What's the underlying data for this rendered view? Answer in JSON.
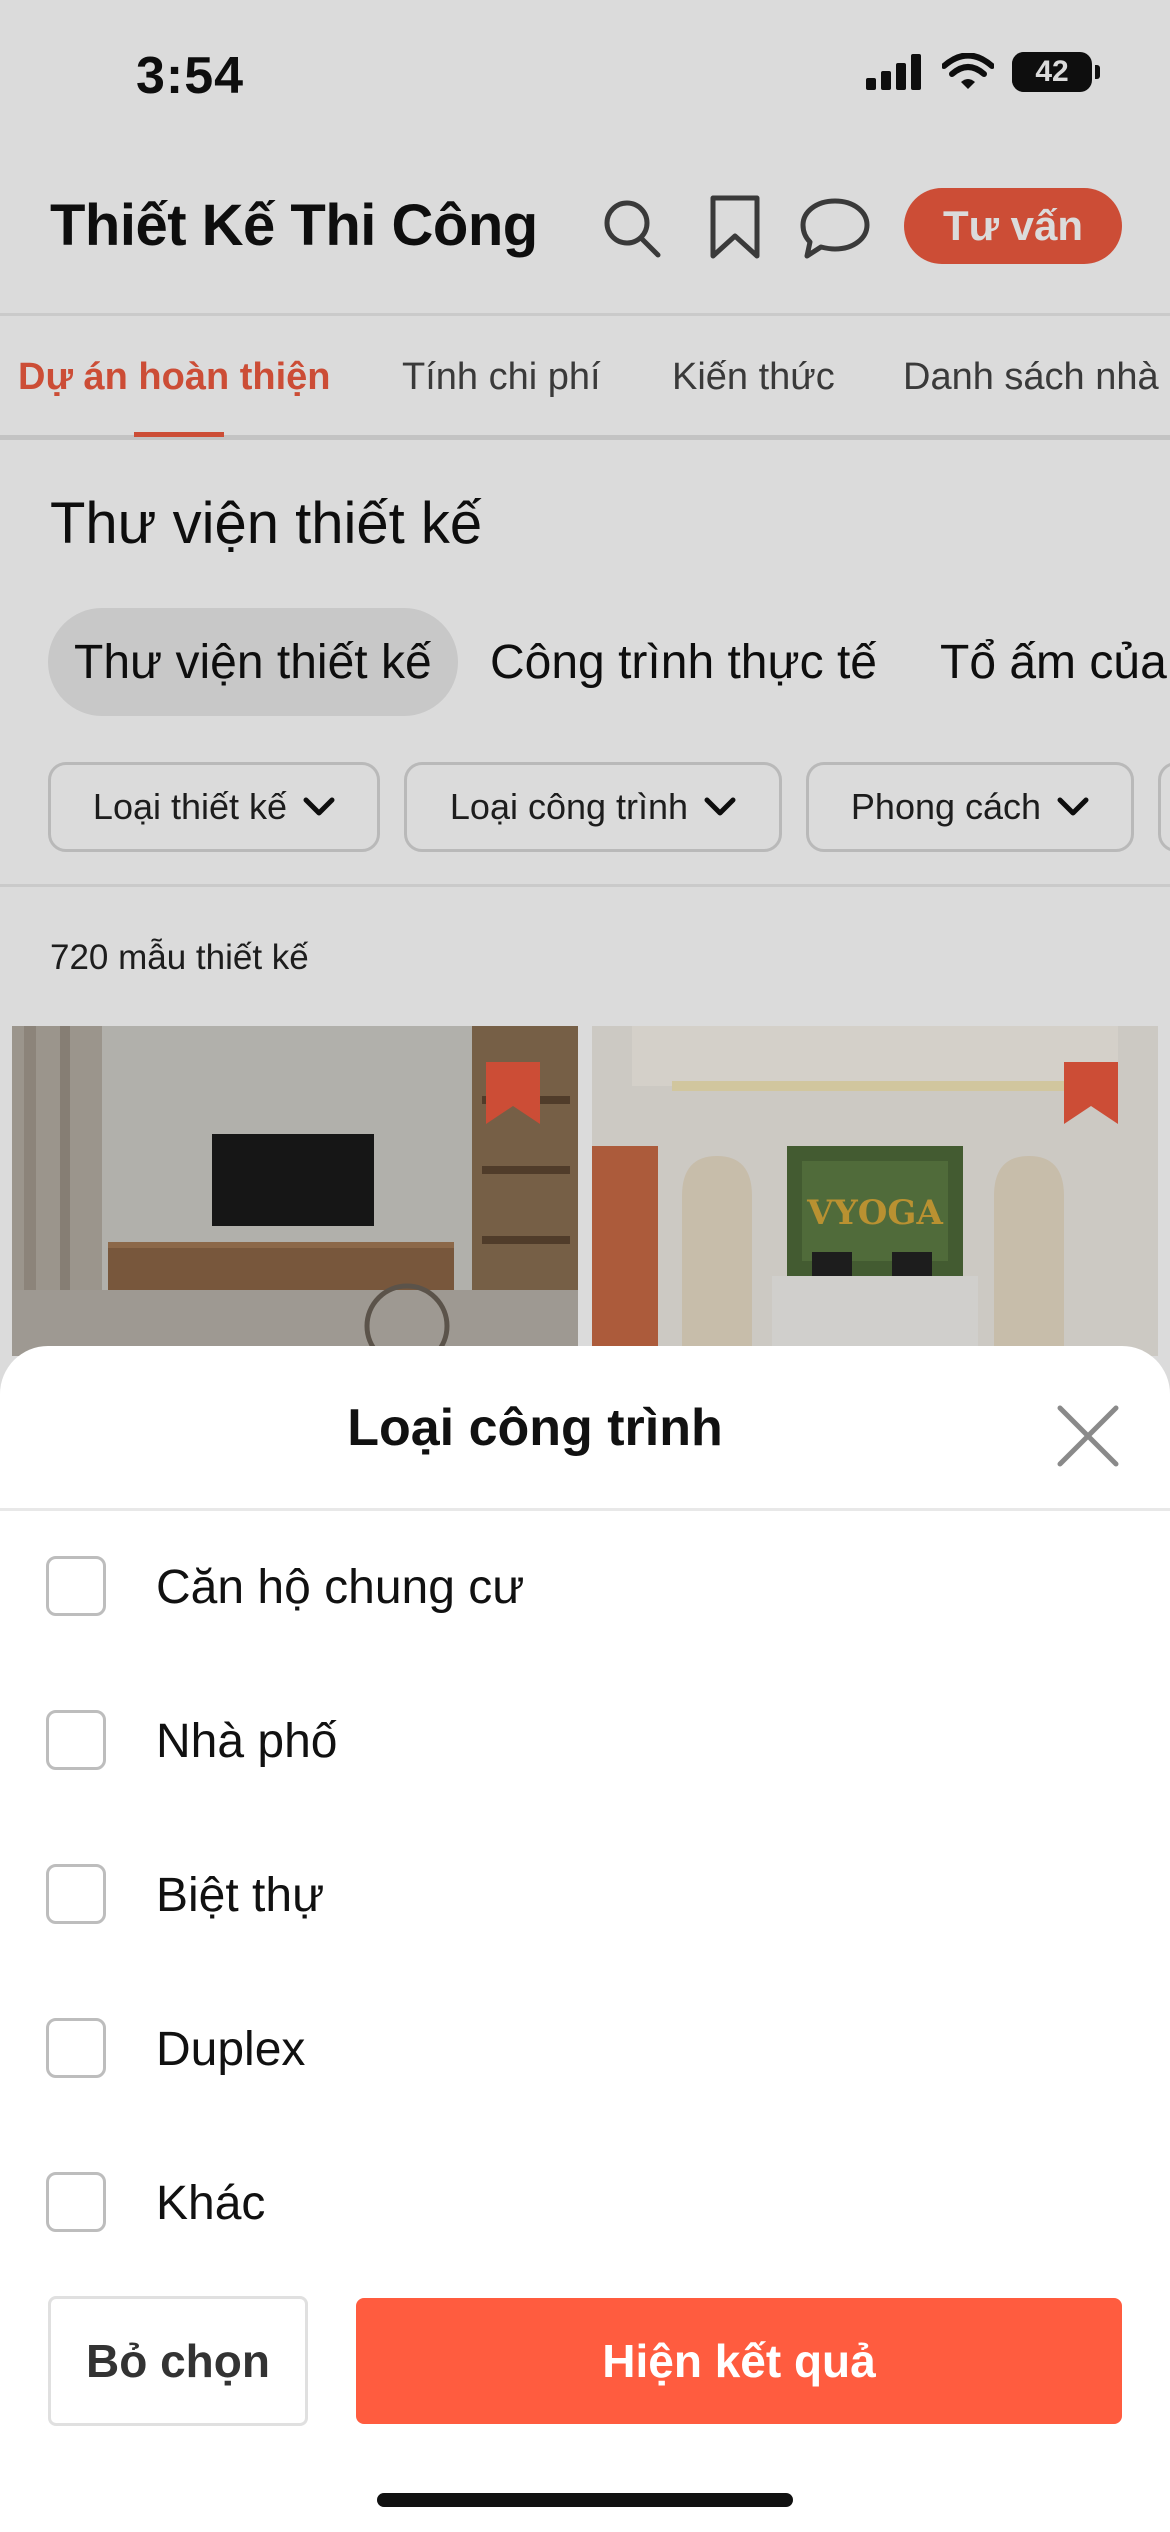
{
  "status_bar": {
    "time": "3:54",
    "battery": "42",
    "battery_level": 0.42
  },
  "header": {
    "title": "Thiết Kế Thi Công",
    "icons": [
      "search-icon",
      "bookmark-icon",
      "chat-icon"
    ],
    "consult_label": "Tư vấn"
  },
  "top_tabs": [
    "Dự án hoàn thiện",
    "Tính chi phí",
    "Kiến thức",
    "Danh sách nhà"
  ],
  "section_title": "Thư viện thiết kế",
  "pills": [
    "Thư viện thiết kế",
    "Công trình thực tế",
    "Tổ ấm của"
  ],
  "filters": [
    "Loại thiết kế",
    "Loại công trình",
    "Phong cách"
  ],
  "result_count": "720 mẫu thiết kế",
  "sheet": {
    "title": "Loại công trình",
    "options": [
      "Căn hộ chung cư",
      "Nhà phố",
      "Biệt thự",
      "Duplex",
      "Khác"
    ],
    "clear_label": "Bỏ chọn",
    "show_label": "Hiện kết quả"
  },
  "colors": {
    "accent": "#ee5a3f",
    "button": "#ff5c3f"
  }
}
